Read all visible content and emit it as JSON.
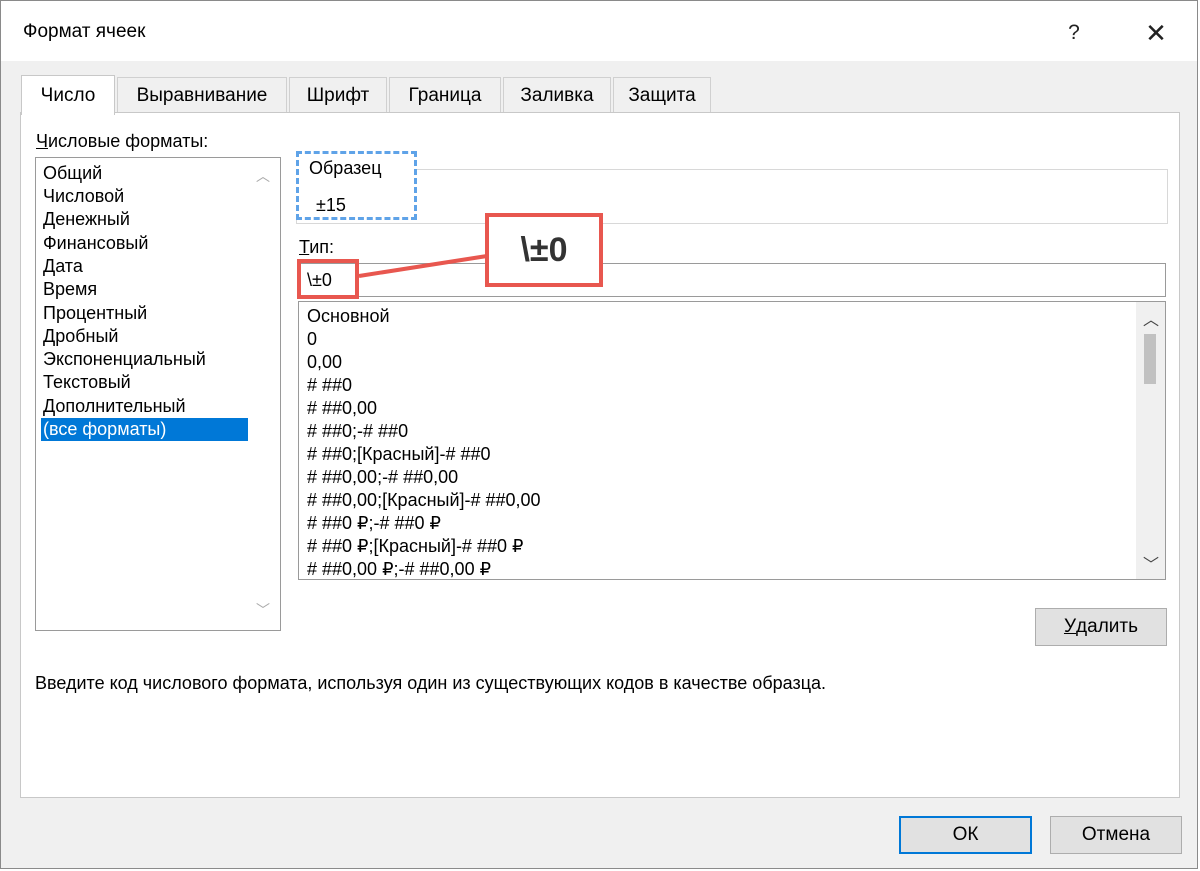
{
  "window": {
    "title": "Формат ячеек",
    "help_label": "?",
    "close_label": "✕"
  },
  "tabs": [
    {
      "label": "Число",
      "active": true
    },
    {
      "label": "Выравнивание",
      "active": false
    },
    {
      "label": "Шрифт",
      "active": false
    },
    {
      "label": "Граница",
      "active": false
    },
    {
      "label": "Заливка",
      "active": false
    },
    {
      "label": "Защита",
      "active": false
    }
  ],
  "category": {
    "label_first": "Ч",
    "label_rest": "исловые форматы:",
    "items": [
      "Общий",
      "Числовой",
      "Денежный",
      "Финансовый",
      "Дата",
      "Время",
      "Процентный",
      "Дробный",
      "Экспоненциальный",
      "Текстовый",
      "Дополнительный",
      "(все форматы)"
    ],
    "selected": "(все форматы)"
  },
  "sample": {
    "label": "Образец",
    "value": "±15"
  },
  "type": {
    "label_first": "Т",
    "label_rest": "ип:",
    "value": "\\±0"
  },
  "callout": {
    "text": "\\±0",
    "color": "#e8574f"
  },
  "highlight_color": "#5fa3e8",
  "codes": [
    "Основной",
    "0",
    "0,00",
    "# ##0",
    "# ##0,00",
    "# ##0;-# ##0",
    "# ##0;[Красный]-# ##0",
    "# ##0,00;-# ##0,00",
    "# ##0,00;[Красный]-# ##0,00",
    "# ##0 ₽;-# ##0 ₽",
    "# ##0 ₽;[Красный]-# ##0 ₽",
    "# ##0,00 ₽;-# ##0,00 ₽"
  ],
  "buttons": {
    "delete_first": "У",
    "delete_rest": "далить",
    "ok": "ОК",
    "cancel": "Отмена"
  },
  "hint": "Введите код числового формата, используя один из существующих кодов в качестве образца.",
  "icons": {
    "scroll_up": "chevron-up-icon",
    "scroll_down": "chevron-down-icon"
  }
}
